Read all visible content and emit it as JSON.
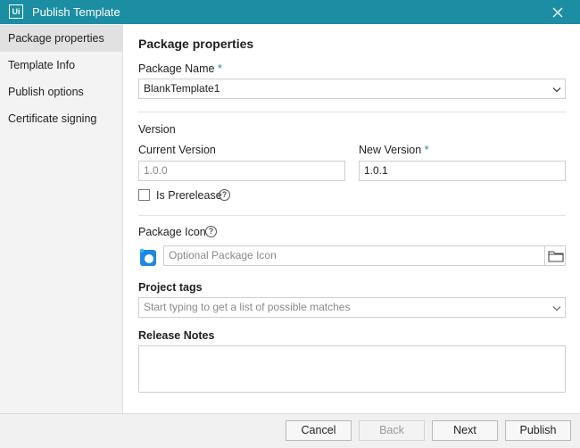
{
  "window": {
    "title": "Publish Template",
    "logo_text": "Ui"
  },
  "sidebar": {
    "items": [
      {
        "label": "Package properties",
        "active": true
      },
      {
        "label": "Template Info"
      },
      {
        "label": "Publish options"
      },
      {
        "label": "Certificate signing"
      }
    ]
  },
  "form": {
    "section_title": "Package properties",
    "package_name": {
      "label": "Package Name",
      "required_mark": "*",
      "value": "BlankTemplate1"
    },
    "version": {
      "label": "Version",
      "current_label": "Current Version",
      "current_value": "1.0.0",
      "new_label": "New Version",
      "new_required_mark": "*",
      "new_value": "1.0.1",
      "prerelease_label": "Is Prerelease",
      "prerelease_checked": false
    },
    "package_icon": {
      "label": "Package Icon",
      "placeholder": "Optional Package Icon"
    },
    "project_tags": {
      "label": "Project tags",
      "placeholder": "Start typing to get a list of possible matches"
    },
    "release_notes": {
      "label": "Release Notes",
      "value": ""
    },
    "help_glyph": "?"
  },
  "footer": {
    "cancel_label": "Cancel",
    "back_label": "Back",
    "next_label": "Next",
    "publish_label": "Publish"
  },
  "colors": {
    "titlebar": "#1b8ea3",
    "accent": "#1b8ea3",
    "sidebar_bg": "#f3f3f3",
    "sidebar_active": "#e1e1e1"
  }
}
